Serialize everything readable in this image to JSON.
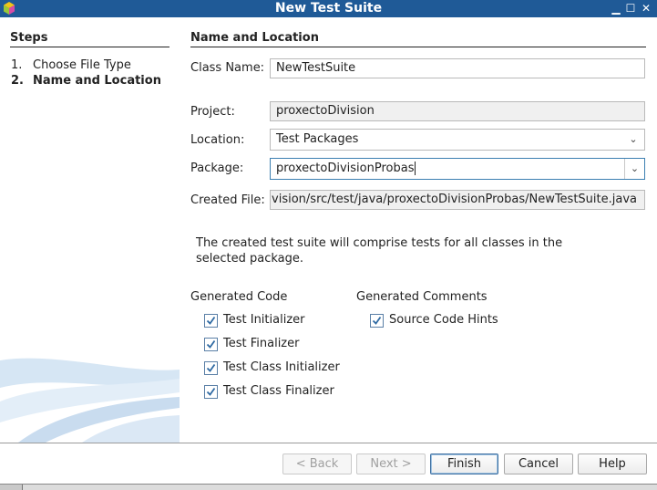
{
  "window": {
    "title": "New Test Suite"
  },
  "steps": {
    "heading": "Steps",
    "items": [
      {
        "num": "1.",
        "label": "Choose File Type"
      },
      {
        "num": "2.",
        "label": "Name and Location"
      }
    ]
  },
  "main": {
    "heading": "Name and Location",
    "class_name": {
      "label": "Class Name:",
      "value": "NewTestSuite"
    },
    "project": {
      "label": "Project:",
      "value": "proxectoDivision"
    },
    "location": {
      "label": "Location:",
      "value": "Test Packages"
    },
    "package": {
      "label": "Package:",
      "value": "proxectoDivisionProbas"
    },
    "created_file": {
      "label": "Created File:",
      "value": "ivision/src/test/java/proxectoDivisionProbas/NewTestSuite.java"
    },
    "description": "The created test suite will comprise tests for all classes in the selected package.",
    "generated_code": {
      "heading": "Generated Code",
      "options": [
        {
          "label": "Test Initializer",
          "checked": true
        },
        {
          "label": "Test Finalizer",
          "checked": true
        },
        {
          "label": "Test Class Initializer",
          "checked": true
        },
        {
          "label": "Test Class Finalizer",
          "checked": true
        }
      ]
    },
    "generated_comments": {
      "heading": "Generated Comments",
      "options": [
        {
          "label": "Source Code Hints",
          "checked": true
        }
      ]
    }
  },
  "buttons": {
    "back": "< Back",
    "next": "Next >",
    "finish": "Finish",
    "cancel": "Cancel",
    "help": "Help"
  },
  "icons": {
    "app": "netbeans-cube-icon",
    "minimize": "minimize-icon",
    "maximize": "maximize-icon",
    "close": "close-icon",
    "dropdown": "chevron-down-icon",
    "check": "checkmark-icon"
  },
  "colors": {
    "titlebar": "#1f5a97",
    "checkbox_border": "#5a7fa6",
    "check": "#2f6aa3"
  }
}
